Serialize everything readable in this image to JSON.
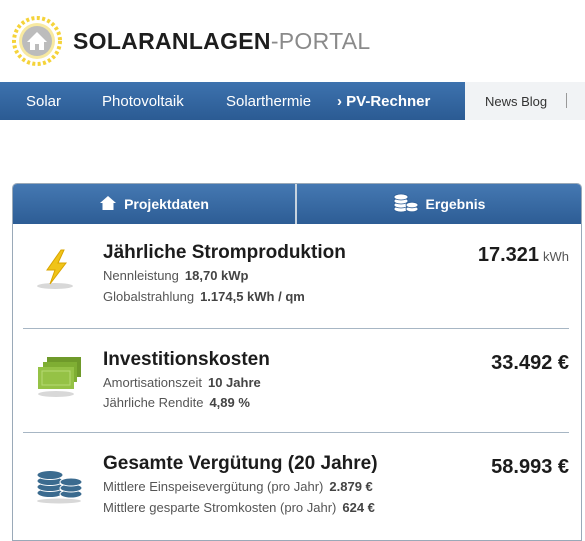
{
  "brand": {
    "strong": "SOLARANLAGEN",
    "light": "-PORTAL",
    "logo_icon": "house-sun-icon"
  },
  "nav": {
    "items": [
      {
        "label": "Solar"
      },
      {
        "label": "Photovoltaik"
      },
      {
        "label": "Solarthermie"
      },
      {
        "label": "› PV-Rechner",
        "active": true
      }
    ],
    "blog": "News Blog",
    "colors": {
      "bar": "#2f5f96",
      "side": "#f1f3f5"
    }
  },
  "tabs": [
    {
      "label": "Projektdaten",
      "icon": "home-icon"
    },
    {
      "label": "Ergebnis",
      "icon": "coins-icon"
    }
  ],
  "results": {
    "power": {
      "icon": "lightning-icon",
      "title": "Jährliche Stromproduktion",
      "line1_label": "Nennleistung",
      "line1_value": "18,70 kWp",
      "line2_label": "Globalstrahlung",
      "line2_value": "1.174,5 kWh / qm",
      "value": "17.321",
      "unit": "kWh"
    },
    "invest": {
      "icon": "banknotes-icon",
      "title": "Investitionskosten",
      "line1_label": "Amortisationszeit",
      "line1_value": "10 Jahre",
      "line2_label": "Jährliche Rendite",
      "line2_value": "4,89 %",
      "value": "33.492 €"
    },
    "total": {
      "icon": "coin-stacks-icon",
      "title": "Gesamte Vergütung (20 Jahre)",
      "line1_label": "Mittlere Einspeisevergütung (pro Jahr)",
      "line1_value": "2.879 €",
      "line2_label": "Mittlere gesparte Stromkosten (pro Jahr)",
      "line2_value": "624 €",
      "value": "58.993 €"
    }
  }
}
